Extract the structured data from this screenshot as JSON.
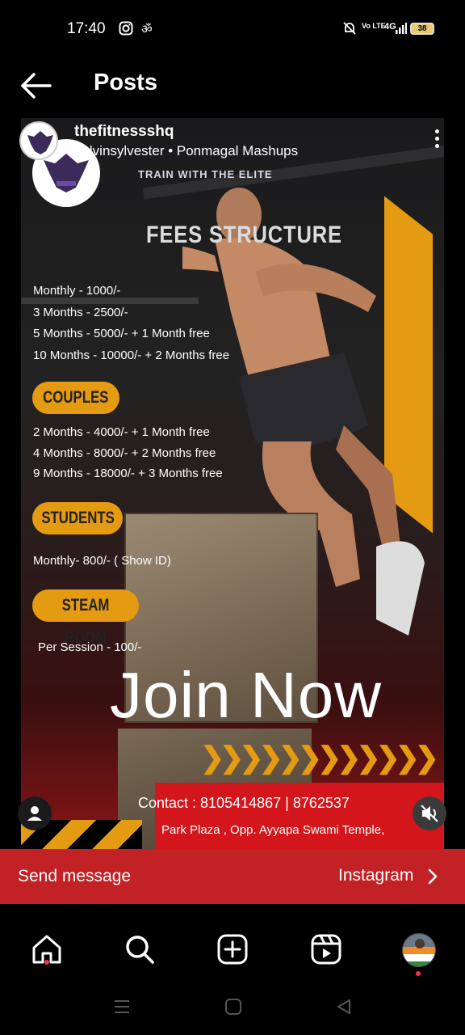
{
  "status_bar": {
    "time": "17:40",
    "battery": "38",
    "network": "4G",
    "volte": "Vo LTE"
  },
  "header": {
    "title": "Posts"
  },
  "post": {
    "username": "thefitnessshq",
    "subline": "nelvinsylvester • Ponmagal Mashups",
    "tagline": "TRAIN WITH THE ELITE",
    "fees_title": "FEES  STRUCTURE",
    "fees": [
      "Monthly - 1000/-",
      "3 Months - 2500/-",
      "5 Months - 5000/-  +  1 Month free",
      "10 Months - 10000/-  +  2 Months free"
    ],
    "couples_label": "COUPLES",
    "couples": [
      "2 Months - 4000/-  +  1 Month free",
      "4 Months - 8000/-  +  2 Months free",
      "9 Months - 18000/-  +  3 Months free"
    ],
    "students_label": "STUDENTS",
    "students": "Monthly- 800/- ( Show ID)",
    "steam_label": "STEAM ROOM",
    "steam": "Per Session - 100/-",
    "join": "Join Now",
    "chevrons": "❯❯❯❯❯❯❯❯❯❯❯❯",
    "contact": "Contact : 8105414867  |  8762537",
    "address": "Park Plaza , Opp. Ayyapa Swami Temple,"
  },
  "send_bar": {
    "send_label": "Send message",
    "instagram_label": "Instagram"
  },
  "colors": {
    "accent_orange": "#e49b12",
    "send_bar": "#c22226",
    "contact_red": "#d2161b",
    "notification_dot": "#ff2d55"
  },
  "icons": {
    "back": "arrow-left-icon",
    "more": "more-vertical-icon",
    "user_tag": "user-icon",
    "mute": "muted-speaker-icon",
    "home": "home-icon",
    "search": "search-icon",
    "create": "plus-square-icon",
    "reels": "reels-icon"
  }
}
